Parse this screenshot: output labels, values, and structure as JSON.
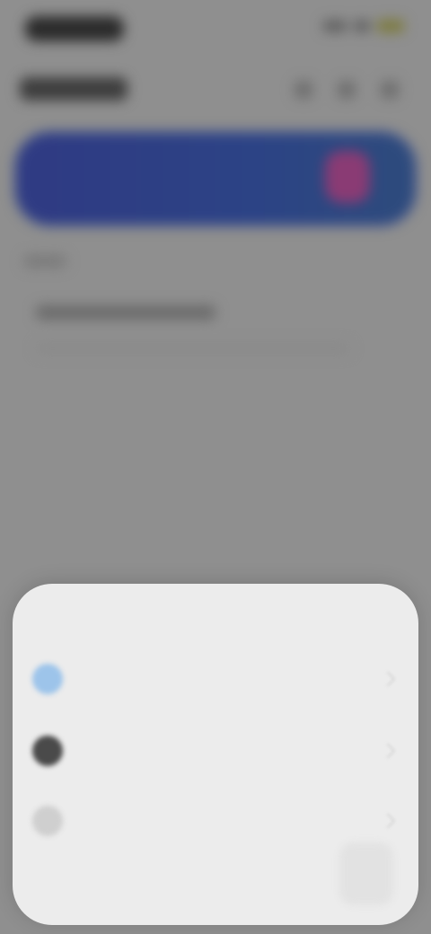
{
  "status_bar": {
    "time": "9:41"
  },
  "header": {
    "title": "Wallet",
    "icons": [
      "search-icon",
      "add-icon",
      "more-icon"
    ]
  },
  "banner": {
    "text": "",
    "badge_icon": "shield-icon"
  },
  "section": {
    "label": "",
    "row_title": "",
    "row_subtitle": ""
  },
  "sheet": {
    "title": "",
    "options": [
      {
        "label": "",
        "icon": "globe-icon"
      },
      {
        "label": "",
        "icon": "circle-icon"
      },
      {
        "label": "",
        "icon": "link-icon"
      }
    ]
  },
  "colors": {
    "banner_start": "#2f3a83",
    "banner_end": "#2d4b7c",
    "badge": "#8a3b74",
    "sheet_bg": "#ececec",
    "accent_blue": "#9dc4ea"
  }
}
